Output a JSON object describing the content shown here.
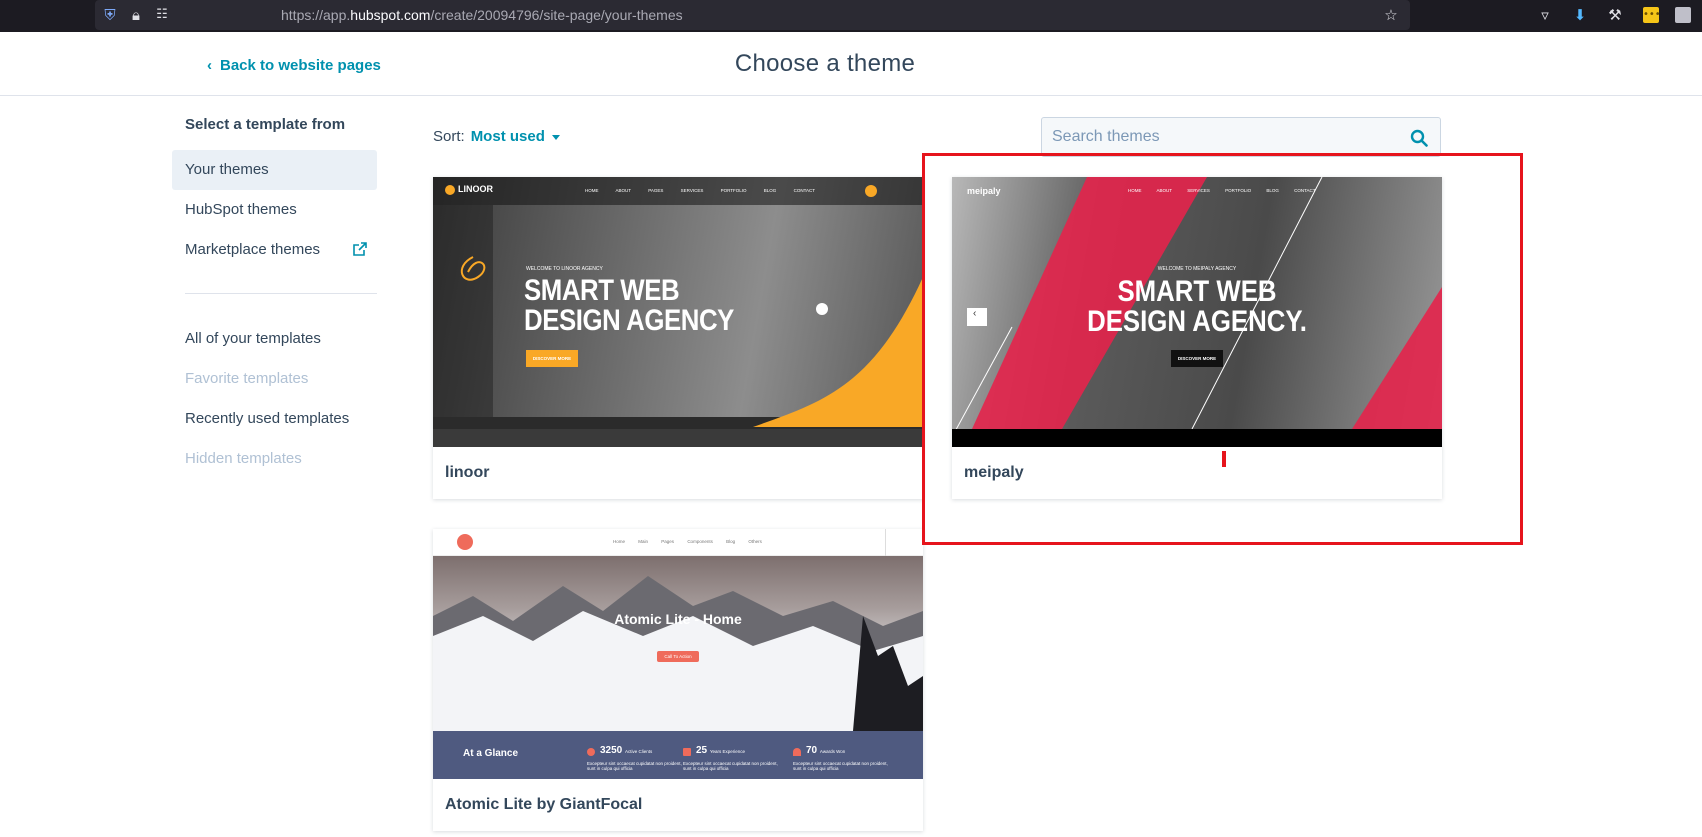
{
  "browser": {
    "url_prefix": "https://app.",
    "url_domain": "hubspot.com",
    "url_path": "/create/20094796/site-page/your-themes"
  },
  "header": {
    "back_label": "Back to website pages",
    "title": "Choose a theme"
  },
  "sidebar": {
    "heading": "Select a template from",
    "sources": [
      {
        "label": "Your themes",
        "active": true
      },
      {
        "label": "HubSpot themes"
      },
      {
        "label": "Marketplace themes",
        "external": true
      }
    ],
    "filters": [
      {
        "label": "All of your templates"
      },
      {
        "label": "Favorite templates",
        "disabled": true
      },
      {
        "label": "Recently used templates"
      },
      {
        "label": "Hidden templates",
        "disabled": true
      }
    ]
  },
  "toolbar": {
    "sort_label": "Sort:",
    "sort_value": "Most used",
    "search_placeholder": "Search themes"
  },
  "themes": [
    {
      "name": "linoor",
      "preview": {
        "logo": "LINOOR",
        "nav": [
          "HOME",
          "ABOUT",
          "PAGES",
          "SERVICES",
          "PORTFOLIO",
          "BLOG",
          "CONTACT"
        ],
        "kicker": "WELCOME TO LINOOR AGENCY",
        "headline_1": "SMART WEB",
        "headline_2": "DESIGN AGENCY",
        "cta": "DISCOVER MORE"
      }
    },
    {
      "name": "meipaly",
      "selected": true,
      "preview": {
        "logo": "meipaly",
        "nav": [
          "HOME",
          "ABOUT",
          "SERVICES",
          "PORTFOLIO",
          "BLOG",
          "CONTACT"
        ],
        "kicker": "WELCOME TO MEIPALY AGENCY",
        "headline_1": "SMART WEB",
        "headline_2": "DESIGN AGENCY.",
        "cta": "DISCOVER MORE"
      }
    },
    {
      "name": "Atomic Lite by GiantFocal",
      "preview": {
        "nav": [
          "Home",
          "Main Pages",
          "Components",
          "Blog",
          "Others"
        ],
        "hero_title": "Atomic Lite - Home",
        "cta": "Call To Action",
        "band_title": "At a Glance",
        "stats": [
          {
            "value": "3250",
            "label": "Active Clients"
          },
          {
            "value": "25",
            "label": "Years Experience"
          },
          {
            "value": "70",
            "label": "Awards Won"
          }
        ],
        "stat_text": "Excepteur sint occaecat cupidatat non proident, sunt in culpa qui officia"
      }
    }
  ],
  "colors": {
    "accent": "#0091ae",
    "text": "#33475b",
    "highlight": "#e6141c",
    "linoor_yellow": "#f9a826",
    "meipaly_red": "#e4244b",
    "atomic_band": "#4f5a80"
  }
}
